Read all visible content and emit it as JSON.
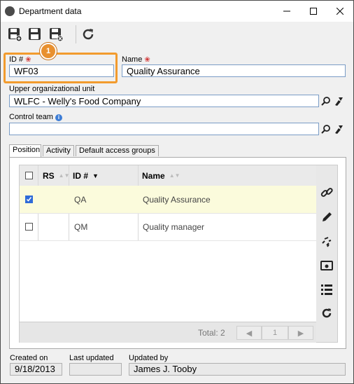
{
  "window": {
    "title": "Department data"
  },
  "form": {
    "id_label": "ID #",
    "id_value": "WF03",
    "name_label": "Name",
    "name_value": "Quality Assurance",
    "upper_unit_label": "Upper organizational unit",
    "upper_unit_value": "WLFC - Welly's Food Company",
    "control_team_label": "Control team",
    "control_team_value": ""
  },
  "badge": "1",
  "tabs": [
    "Position",
    "Activity",
    "Default access groups"
  ],
  "grid": {
    "columns": [
      "RS",
      "ID #",
      "Name"
    ],
    "rows": [
      {
        "checked": true,
        "rs": "",
        "id": "QA",
        "name": "Quality Assurance"
      },
      {
        "checked": false,
        "rs": "",
        "id": "QM",
        "name": "Quality manager"
      }
    ],
    "total": "Total: 2",
    "page": "1"
  },
  "footer": {
    "created_label": "Created on",
    "created_value": "9/18/2013",
    "updated_label": "Last updated",
    "updated_value": "",
    "updated_by_label": "Updated by",
    "updated_by_value": "James J. Tooby"
  },
  "icons": [
    "app-icon",
    "minimize-icon",
    "maximize-icon",
    "close-icon",
    "save-new-icon",
    "save-icon",
    "save-close-icon",
    "refresh-icon",
    "search-icon",
    "clear-icon",
    "info-icon",
    "link-icon",
    "edit-icon",
    "unlink-icon",
    "view-icon",
    "list-icon",
    "refresh-icon"
  ]
}
